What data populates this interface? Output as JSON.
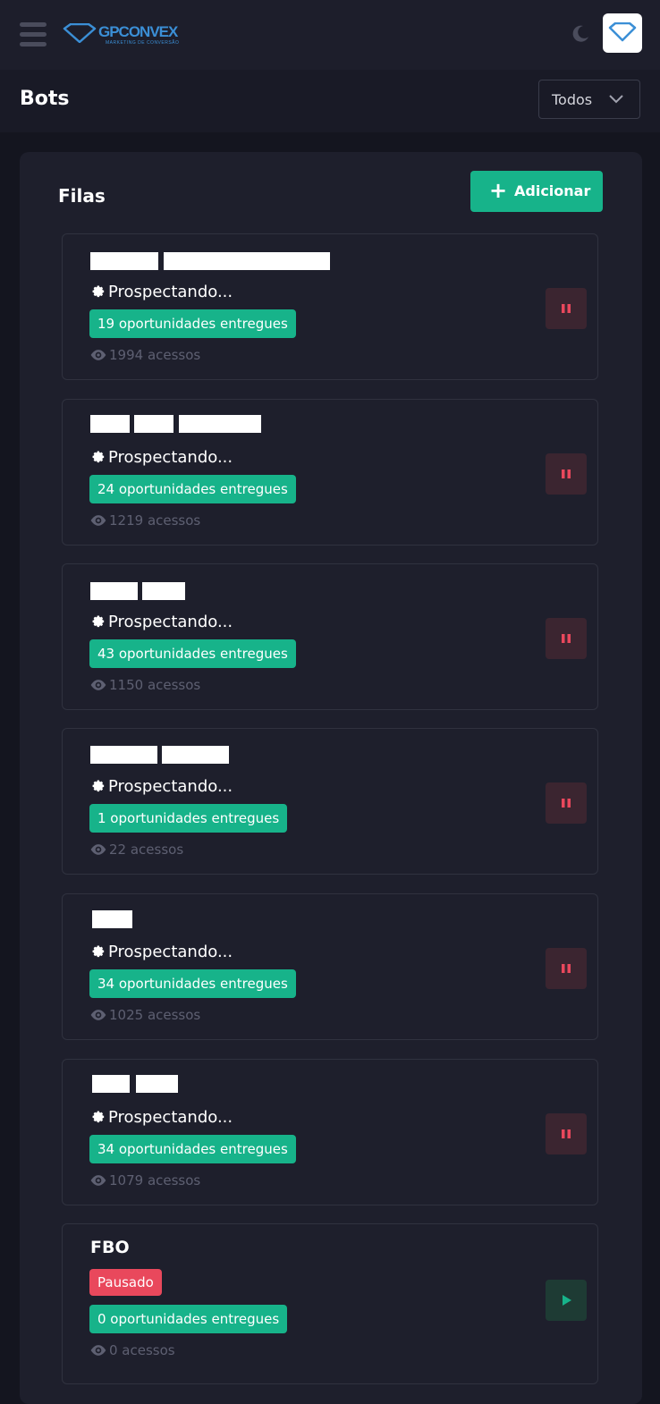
{
  "brand": {
    "name": "GPCONVEX",
    "tagline": "MARKETING DE CONVERSÃO",
    "accent": "#3b8fd6"
  },
  "header": {
    "title": "Bots",
    "filter": "Todos"
  },
  "panel": {
    "title": "Filas",
    "add_label": "Adicionar"
  },
  "colors": {
    "green": "#17b38a",
    "red": "#e9485c",
    "background": "#14151f",
    "card": "#1e1f2c"
  },
  "queues": [
    {
      "status": "Prospectando...",
      "opportunities": "19 oportunidades entregues",
      "views": "1994 acessos",
      "action": "pause"
    },
    {
      "status": "Prospectando...",
      "opportunities": "24 oportunidades entregues",
      "views": "1219 acessos",
      "action": "pause"
    },
    {
      "status": "Prospectando...",
      "opportunities": "43 oportunidades entregues",
      "views": "1150 acessos",
      "action": "pause"
    },
    {
      "status": "Prospectando...",
      "opportunities": "1 oportunidades entregues",
      "views": "22 acessos",
      "action": "pause"
    },
    {
      "status": "Prospectando...",
      "opportunities": "34 oportunidades entregues",
      "views": "1025 acessos",
      "action": "pause"
    },
    {
      "status": "Prospectando...",
      "opportunities": "34 oportunidades entregues",
      "views": "1079 acessos",
      "action": "pause"
    },
    {
      "name": "FBO",
      "status": "Pausado",
      "opportunities": "0 oportunidades entregues",
      "views": "0 acessos",
      "action": "play"
    }
  ]
}
